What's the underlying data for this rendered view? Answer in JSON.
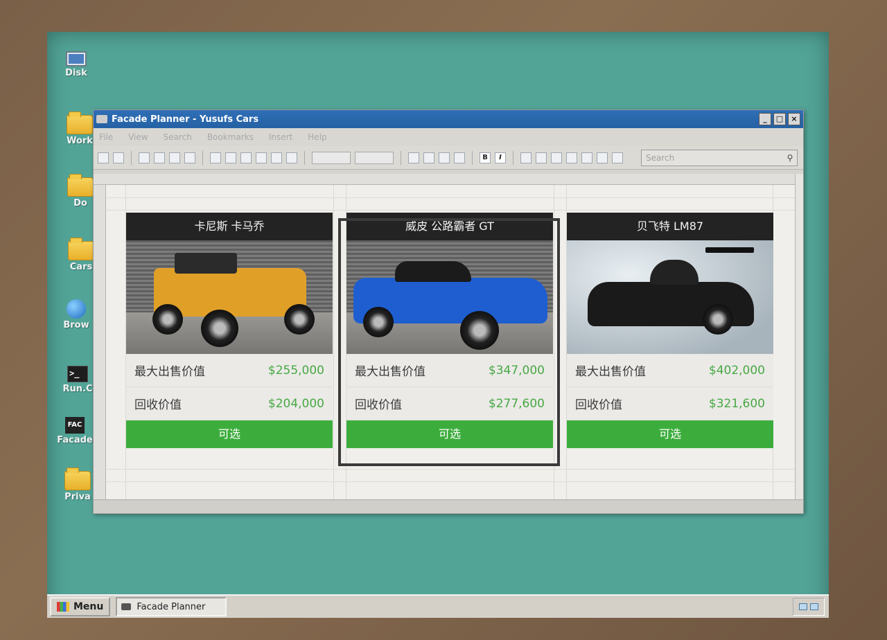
{
  "window": {
    "title": "Facade Planner - Yusufs Cars",
    "minimize_label": "_",
    "maximize_label": "□",
    "close_label": "×"
  },
  "menu": [
    "File",
    "View",
    "Search",
    "Bookmarks",
    "Insert",
    "Help"
  ],
  "toolbar": {
    "search_placeholder": "Search",
    "bold_label": "B",
    "italic_label": "I"
  },
  "desktop_icons": [
    {
      "label": "Disk",
      "icon": "computer-icon"
    },
    {
      "label": "Work",
      "icon": "folder-icon"
    },
    {
      "label": "Do",
      "icon": "folder-icon"
    },
    {
      "label": "Cars",
      "icon": "folder-icon"
    },
    {
      "label": "Brow",
      "icon": "globe-icon"
    },
    {
      "label": "Run.C",
      "icon": "terminal-icon"
    },
    {
      "label": "Facade",
      "icon": "facade-icon"
    },
    {
      "label": "Priva",
      "icon": "folder-icon"
    }
  ],
  "cars": [
    {
      "name": "卡尼斯 卡马乔",
      "max_sale_label": "最大出售价值",
      "max_sale_value": "$255,000",
      "buyback_label": "回收价值",
      "buyback_value": "$204,000",
      "button_label": "可选",
      "selected": false,
      "body_color": "#e0a028"
    },
    {
      "name": "威皮 公路霸者 GT",
      "max_sale_label": "最大出售价值",
      "max_sale_value": "$347,000",
      "buyback_label": "回收价值",
      "buyback_value": "$277,600",
      "button_label": "可选",
      "selected": true,
      "body_color": "#1e5ed0"
    },
    {
      "name": "贝飞特 LM87",
      "max_sale_label": "最大出售价值",
      "max_sale_value": "$402,000",
      "buyback_label": "回收价值",
      "buyback_value": "$321,600",
      "button_label": "可选",
      "selected": false,
      "body_color": "#1a1a1a"
    }
  ],
  "taskbar": {
    "start_label": "Menu",
    "task_label": "Facade Planner"
  },
  "colors": {
    "accent_green": "#3cad3c",
    "price_green": "#47a843",
    "titlebar_blue": "#2f6fb6",
    "desktop_teal": "#52a497"
  }
}
